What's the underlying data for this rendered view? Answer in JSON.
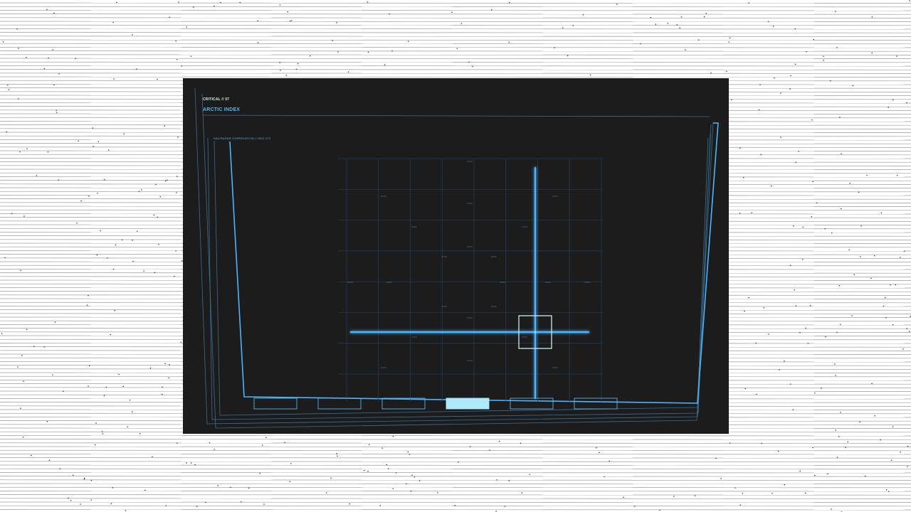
{
  "header": {
    "tag": "CRITICAL // 07",
    "title": "ARCTIC INDEX"
  },
  "viewport": {
    "label": "NAV/RADAR CORRELATION // HDG 072"
  },
  "crosshair": {
    "lock_icon": "target-lock-square-icon"
  },
  "segments": {
    "count": 6,
    "active_index": 3
  },
  "colors": {
    "accent": "#59b3e8",
    "accent_glow": "#4fb4ff",
    "grid": "#23405a",
    "panel_bg": "#1c1c1c",
    "active_segment": "#aee9fc",
    "text_light": "#d8ecf4"
  }
}
